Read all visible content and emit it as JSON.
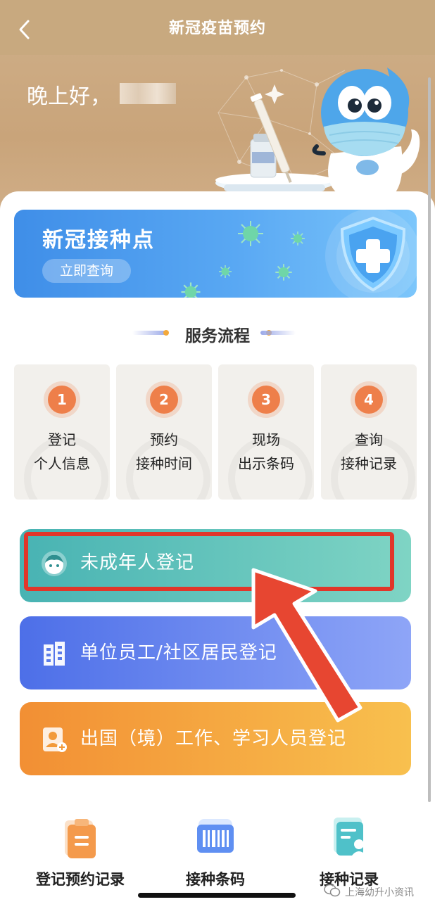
{
  "navbar": {
    "title": "新冠疫苗预约"
  },
  "header": {
    "greeting": "晚上好，"
  },
  "banner": {
    "title": "新冠接种点",
    "button": "立即查询"
  },
  "process": {
    "title": "服务流程",
    "steps": [
      {
        "num": "1",
        "line1": "登记",
        "line2": "个人信息"
      },
      {
        "num": "2",
        "line1": "预约",
        "line2": "接种时间"
      },
      {
        "num": "3",
        "line1": "现场",
        "line2": "出示条码"
      },
      {
        "num": "4",
        "line1": "查询",
        "line2": "接种记录"
      }
    ]
  },
  "registration": {
    "minor": "未成年人登记",
    "unit": "单位员工/社区居民登记",
    "abroad": "出国（境）工作、学习人员登记"
  },
  "bottom_nav": {
    "items": [
      {
        "label": "登记预约记录",
        "icon": "clipboard-icon"
      },
      {
        "label": "接种条码",
        "icon": "barcode-icon"
      },
      {
        "label": "接种记录",
        "icon": "document-user-icon"
      }
    ]
  },
  "watermark": {
    "text": "上海幼升小资讯"
  },
  "colors": {
    "header": "#c8a97f",
    "banner": "#3f8ee8",
    "step_number": "#ee7f4a",
    "minor_button": "#48b3b3",
    "unit_button": "#4d6fe8",
    "abroad_button": "#f28f34",
    "highlight": "#e1362a"
  }
}
